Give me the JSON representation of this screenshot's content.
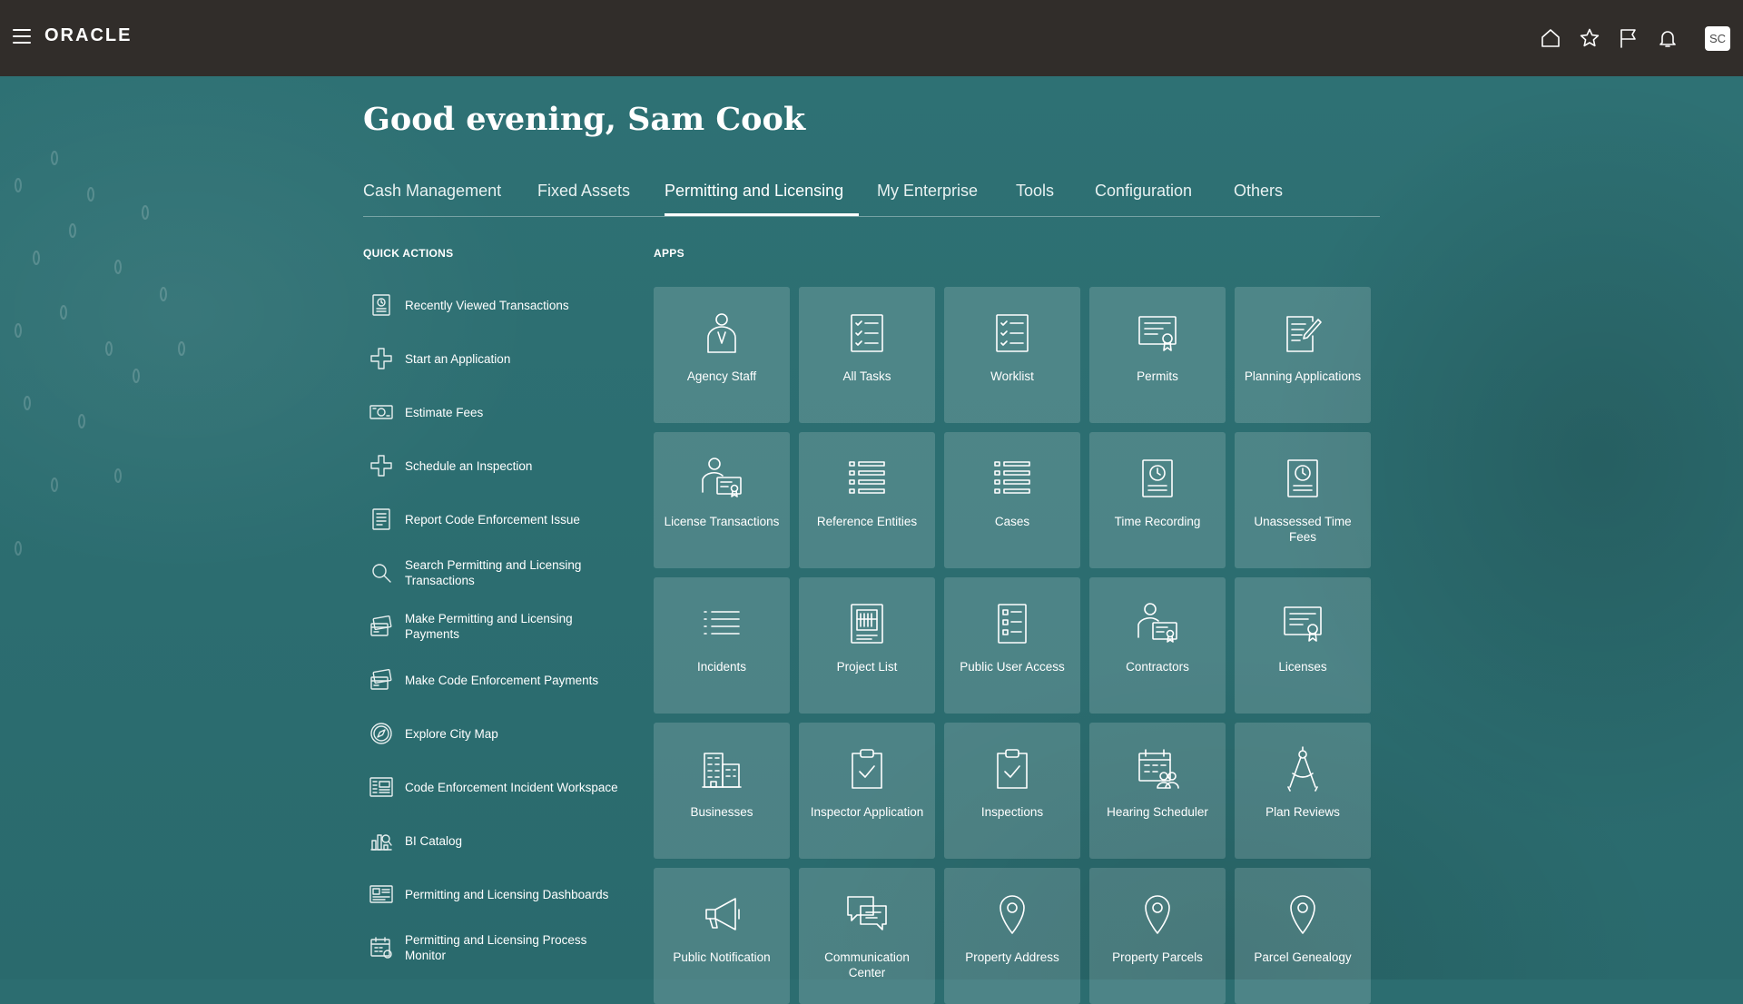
{
  "header": {
    "brand": "ORACLE",
    "avatar_initials": "SC",
    "icons": [
      "menu-icon",
      "home-icon",
      "star-icon",
      "flag-icon",
      "bell-icon"
    ]
  },
  "greeting": "Good evening, Sam Cook",
  "tabs": [
    {
      "label": "Cash Management"
    },
    {
      "label": "Fixed Assets"
    },
    {
      "label": "Permitting and Licensing"
    },
    {
      "label": "My Enterprise"
    },
    {
      "label": "Tools"
    },
    {
      "label": "Configuration"
    },
    {
      "label": "Others"
    }
  ],
  "active_tab": "Permitting and Licensing",
  "quick_actions": {
    "title": "QUICK ACTIONS",
    "items": [
      {
        "label": "Recently Viewed Transactions",
        "icon": "recent-icon"
      },
      {
        "label": "Start an Application",
        "icon": "plus-icon"
      },
      {
        "label": "Estimate Fees",
        "icon": "money-icon"
      },
      {
        "label": "Schedule an Inspection",
        "icon": "plus-icon"
      },
      {
        "label": "Report Code Enforcement Issue",
        "icon": "report-icon"
      },
      {
        "label": "Search Permitting and Licensing Transactions",
        "icon": "search-icon"
      },
      {
        "label": "Make Permitting and Licensing Payments",
        "icon": "payment-icon"
      },
      {
        "label": "Make Code Enforcement Payments",
        "icon": "payment-icon"
      },
      {
        "label": "Explore City Map",
        "icon": "compass-icon"
      },
      {
        "label": "Code Enforcement Incident Workspace",
        "icon": "workspace-icon"
      },
      {
        "label": "BI Catalog",
        "icon": "catalog-icon"
      },
      {
        "label": "Permitting and Licensing Dashboards",
        "icon": "dashboard-icon"
      },
      {
        "label": "Permitting and Licensing Process Monitor",
        "icon": "monitor-icon"
      }
    ]
  },
  "apps": {
    "title": "APPS",
    "items": [
      {
        "label": "Agency Staff",
        "icon": "person-badge-icon"
      },
      {
        "label": "All Tasks",
        "icon": "checklist-icon"
      },
      {
        "label": "Worklist",
        "icon": "checklist-icon"
      },
      {
        "label": "Permits",
        "icon": "certificate-icon"
      },
      {
        "label": "Planning Applications",
        "icon": "document-pencil-icon"
      },
      {
        "label": "License Transactions",
        "icon": "person-certificate-icon"
      },
      {
        "label": "Reference Entities",
        "icon": "list-icon"
      },
      {
        "label": "Cases",
        "icon": "list-icon"
      },
      {
        "label": "Time Recording",
        "icon": "clock-document-icon"
      },
      {
        "label": "Unassessed Time Fees",
        "icon": "clock-document-icon"
      },
      {
        "label": "Incidents",
        "icon": "bulleted-list-icon"
      },
      {
        "label": "Project List",
        "icon": "building-document-icon"
      },
      {
        "label": "Public User Access",
        "icon": "form-document-icon"
      },
      {
        "label": "Contractors",
        "icon": "person-certificate-icon"
      },
      {
        "label": "Licenses",
        "icon": "certificate-icon"
      },
      {
        "label": "Businesses",
        "icon": "buildings-icon"
      },
      {
        "label": "Inspector Application",
        "icon": "clipboard-check-icon"
      },
      {
        "label": "Inspections",
        "icon": "clipboard-check-icon"
      },
      {
        "label": "Hearing Scheduler",
        "icon": "calendar-people-icon"
      },
      {
        "label": "Plan Reviews",
        "icon": "compass-tool-icon"
      },
      {
        "label": "Public Notification",
        "icon": "megaphone-icon"
      },
      {
        "label": "Communication Center",
        "icon": "chat-icon"
      },
      {
        "label": "Property Address",
        "icon": "location-pin-icon"
      },
      {
        "label": "Property Parcels",
        "icon": "location-pin-icon"
      },
      {
        "label": "Parcel Genealogy",
        "icon": "location-pin-icon"
      }
    ]
  },
  "colors": {
    "header_bg": "#312d2a",
    "page_bg": "#2c6d70",
    "tile_bg": "rgba(255,255,255,0.16)"
  }
}
